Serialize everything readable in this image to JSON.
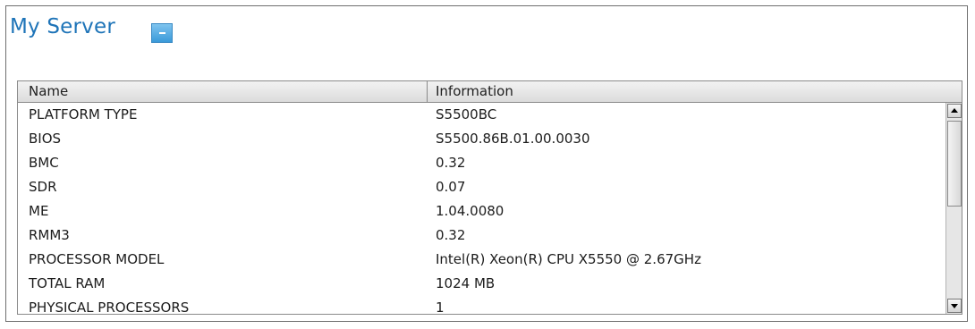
{
  "panel": {
    "title": "My Server",
    "collapse_icon": "minus-icon"
  },
  "table": {
    "columns": [
      "Name",
      "Information"
    ],
    "rows": [
      {
        "name": "PLATFORM TYPE",
        "value": "S5500BC"
      },
      {
        "name": "BIOS",
        "value": "S5500.86B.01.00.0030"
      },
      {
        "name": "BMC",
        "value": "0.32"
      },
      {
        "name": "SDR",
        "value": "0.07"
      },
      {
        "name": "ME",
        "value": "1.04.0080"
      },
      {
        "name": "RMM3",
        "value": "0.32"
      },
      {
        "name": "PROCESSOR MODEL",
        "value": "Intel(R) Xeon(R) CPU X5550 @ 2.67GHz"
      },
      {
        "name": "TOTAL RAM",
        "value": "1024 MB"
      },
      {
        "name": "PHYSICAL PROCESSORS",
        "value": "1"
      }
    ]
  },
  "colors": {
    "title": "#1e74b8",
    "accent": "#3a9ad9"
  }
}
